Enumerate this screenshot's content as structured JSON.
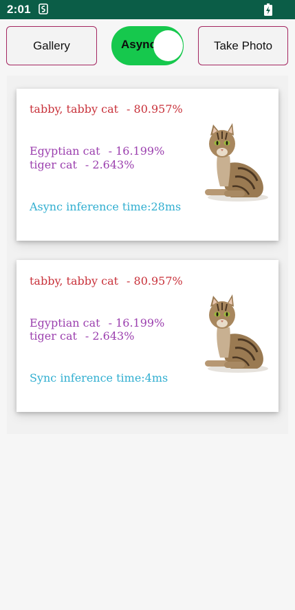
{
  "status_bar": {
    "time": "2:01"
  },
  "toolbar": {
    "gallery_label": "Gallery",
    "toggle_label": "Async",
    "toggle_on": true,
    "take_photo_label": "Take Photo"
  },
  "colors": {
    "status_bar": "#0b5d47",
    "button_border": "#a3245f",
    "toggle_on": "#16c84d",
    "top_prediction": "#c8313a",
    "other_predictions": "#9b3fae",
    "inference_time": "#30aed0"
  },
  "cards": [
    {
      "predictions": [
        {
          "label": "tabby, tabby cat",
          "score": "- 80.957%"
        },
        {
          "label": "Egyptian cat",
          "score": "- 16.199%"
        },
        {
          "label": "tiger cat",
          "score": "- 2.643%"
        }
      ],
      "inference_text": "Async inference time:28ms"
    },
    {
      "predictions": [
        {
          "label": "tabby, tabby cat",
          "score": "- 80.957%"
        },
        {
          "label": "Egyptian cat",
          "score": "- 16.199%"
        },
        {
          "label": "tiger cat",
          "score": "- 2.643%"
        }
      ],
      "inference_text": "Sync inference time:4ms"
    }
  ]
}
